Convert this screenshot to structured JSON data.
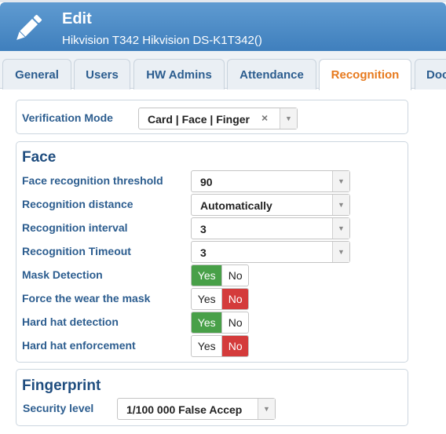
{
  "header": {
    "title": "Edit",
    "subtitle": "Hikvision T342 Hikvision DS-K1T342()"
  },
  "tabs": [
    {
      "label": "General",
      "active": false
    },
    {
      "label": "Users",
      "active": false
    },
    {
      "label": "HW Admins",
      "active": false
    },
    {
      "label": "Attendance",
      "active": false
    },
    {
      "label": "Recognition",
      "active": true
    },
    {
      "label": "Doc",
      "active": false
    }
  ],
  "verification": {
    "label": "Verification Mode",
    "value": "Card | Face | Finger",
    "clear_icon": "×"
  },
  "face": {
    "title": "Face",
    "threshold": {
      "label": "Face recognition threshold",
      "value": "90"
    },
    "distance": {
      "label": "Recognition distance",
      "value": "Automatically"
    },
    "interval": {
      "label": "Recognition interval",
      "value": "3"
    },
    "timeout": {
      "label": "Recognition Timeout",
      "value": "3"
    },
    "mask_detection": {
      "label": "Mask Detection",
      "yes": "Yes",
      "no": "No",
      "selected": "yes"
    },
    "force_mask": {
      "label": "Force the wear the mask",
      "yes": "Yes",
      "no": "No",
      "selected": "no"
    },
    "hard_hat_detection": {
      "label": "Hard hat detection",
      "yes": "Yes",
      "no": "No",
      "selected": "yes"
    },
    "hard_hat_enforcement": {
      "label": "Hard hat enforcement",
      "yes": "Yes",
      "no": "No",
      "selected": "no"
    }
  },
  "fingerprint": {
    "title": "Fingerprint",
    "security": {
      "label": "Security level",
      "value": "1/100 000 False Accep"
    }
  },
  "colors": {
    "header": "#4a8ac7",
    "active_tab_text": "#e77a1e",
    "label_text": "#2c5d8f",
    "yes_on": "#48a048",
    "no_on": "#d43b3b"
  },
  "icons": {
    "edit": "pencil-icon",
    "dropdown": "chevron-down-icon",
    "clear": "close-icon"
  }
}
